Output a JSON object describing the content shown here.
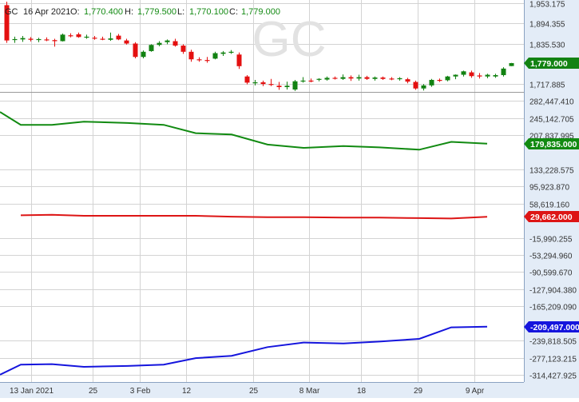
{
  "header": {
    "symbol": "GC",
    "date": "16 Apr 2021",
    "o_label": "O:",
    "o_value": "1,770.400",
    "h_label": "H:",
    "h_value": "1,779.500",
    "l_label": "L:",
    "l_value": "1,770.100",
    "c_label": "C:",
    "c_value": "1,779.000"
  },
  "watermark": "GC",
  "colors": {
    "up": "#128212",
    "down": "#e41010",
    "green_line": "#118a11",
    "red_line": "#dd1515",
    "blue_line": "#1515dd",
    "axis_bg": "#e3ecf7",
    "grid": "#d3d3d3",
    "tick_text": "#333333",
    "header_value": "#138a13"
  },
  "chart_data": {
    "type": "candlestick+line",
    "x_ticks": [
      {
        "label": "13 Jan 2021",
        "date": "2021-01-13"
      },
      {
        "label": "25",
        "date": "2021-01-25"
      },
      {
        "label": "3 Feb",
        "date": "2021-02-03"
      },
      {
        "label": "12",
        "date": "2021-02-12"
      },
      {
        "label": "25",
        "date": "2021-02-25"
      },
      {
        "label": "8 Mar",
        "date": "2021-03-08"
      },
      {
        "label": "18",
        "date": "2021-03-18"
      },
      {
        "label": "29",
        "date": "2021-03-29"
      },
      {
        "label": "9 Apr",
        "date": "2021-04-09"
      }
    ],
    "price_panel": {
      "y_ticks": [
        "1,953.175",
        "1,894.355",
        "1,835.530",
        "1,717.885"
      ],
      "y_range": [
        1695,
        1963
      ],
      "last_value_label": "1,779.000",
      "candles": [
        {
          "o": 1948,
          "h": 1958,
          "l": 1838,
          "c": 1845
        },
        {
          "o": 1847,
          "h": 1856,
          "l": 1838,
          "c": 1849
        },
        {
          "o": 1848,
          "h": 1858,
          "l": 1841,
          "c": 1852
        },
        {
          "o": 1850,
          "h": 1855,
          "l": 1842,
          "c": 1847
        },
        {
          "o": 1847,
          "h": 1853,
          "l": 1840,
          "c": 1849
        },
        {
          "o": 1848,
          "h": 1854,
          "l": 1843,
          "c": 1846
        },
        {
          "o": 1846,
          "h": 1850,
          "l": 1827,
          "c": 1843
        },
        {
          "o": 1843,
          "h": 1865,
          "l": 1842,
          "c": 1862
        },
        {
          "o": 1860,
          "h": 1866,
          "l": 1854,
          "c": 1858
        },
        {
          "o": 1863,
          "h": 1868,
          "l": 1853,
          "c": 1855
        },
        {
          "o": 1855,
          "h": 1862,
          "l": 1850,
          "c": 1856
        },
        {
          "o": 1853,
          "h": 1858,
          "l": 1847,
          "c": 1852
        },
        {
          "o": 1850,
          "h": 1856,
          "l": 1846,
          "c": 1849
        },
        {
          "o": 1847,
          "h": 1868,
          "l": 1844,
          "c": 1851
        },
        {
          "o": 1859,
          "h": 1864,
          "l": 1846,
          "c": 1848
        },
        {
          "o": 1845,
          "h": 1850,
          "l": 1833,
          "c": 1836
        },
        {
          "o": 1836,
          "h": 1840,
          "l": 1793,
          "c": 1797
        },
        {
          "o": 1797,
          "h": 1816,
          "l": 1793,
          "c": 1812
        },
        {
          "o": 1814,
          "h": 1834,
          "l": 1812,
          "c": 1832
        },
        {
          "o": 1832,
          "h": 1843,
          "l": 1828,
          "c": 1838
        },
        {
          "o": 1840,
          "h": 1848,
          "l": 1834,
          "c": 1845
        },
        {
          "o": 1843,
          "h": 1850,
          "l": 1827,
          "c": 1830
        },
        {
          "o": 1830,
          "h": 1834,
          "l": 1806,
          "c": 1812
        },
        {
          "o": 1812,
          "h": 1818,
          "l": 1783,
          "c": 1790
        },
        {
          "o": 1790,
          "h": 1796,
          "l": 1783,
          "c": 1788
        },
        {
          "o": 1788,
          "h": 1797,
          "l": 1780,
          "c": 1786
        },
        {
          "o": 1792,
          "h": 1812,
          "l": 1790,
          "c": 1808
        },
        {
          "o": 1806,
          "h": 1814,
          "l": 1800,
          "c": 1810
        },
        {
          "o": 1810,
          "h": 1817,
          "l": 1806,
          "c": 1812
        },
        {
          "o": 1804,
          "h": 1810,
          "l": 1762,
          "c": 1770
        },
        {
          "o": 1740,
          "h": 1744,
          "l": 1717,
          "c": 1722
        },
        {
          "o": 1722,
          "h": 1730,
          "l": 1714,
          "c": 1723
        },
        {
          "o": 1723,
          "h": 1728,
          "l": 1712,
          "c": 1718
        },
        {
          "o": 1718,
          "h": 1733,
          "l": 1712,
          "c": 1716
        },
        {
          "o": 1713,
          "h": 1724,
          "l": 1701,
          "c": 1709
        },
        {
          "o": 1709,
          "h": 1725,
          "l": 1702,
          "c": 1713
        },
        {
          "o": 1702,
          "h": 1730,
          "l": 1698,
          "c": 1726
        },
        {
          "o": 1726,
          "h": 1738,
          "l": 1722,
          "c": 1728
        },
        {
          "o": 1728,
          "h": 1734,
          "l": 1723,
          "c": 1727
        },
        {
          "o": 1731,
          "h": 1735,
          "l": 1726,
          "c": 1733
        },
        {
          "o": 1731,
          "h": 1740,
          "l": 1728,
          "c": 1736
        },
        {
          "o": 1736,
          "h": 1740,
          "l": 1731,
          "c": 1735
        },
        {
          "o": 1733,
          "h": 1746,
          "l": 1730,
          "c": 1738
        },
        {
          "o": 1738,
          "h": 1743,
          "l": 1727,
          "c": 1734
        },
        {
          "o": 1734,
          "h": 1745,
          "l": 1728,
          "c": 1738
        },
        {
          "o": 1738,
          "h": 1742,
          "l": 1730,
          "c": 1733
        },
        {
          "o": 1733,
          "h": 1740,
          "l": 1728,
          "c": 1737
        },
        {
          "o": 1737,
          "h": 1740,
          "l": 1730,
          "c": 1733
        },
        {
          "o": 1734,
          "h": 1738,
          "l": 1729,
          "c": 1732
        },
        {
          "o": 1732,
          "h": 1738,
          "l": 1728,
          "c": 1735
        },
        {
          "o": 1732,
          "h": 1736,
          "l": 1720,
          "c": 1725
        },
        {
          "o": 1724,
          "h": 1728,
          "l": 1701,
          "c": 1705
        },
        {
          "o": 1705,
          "h": 1718,
          "l": 1699,
          "c": 1714
        },
        {
          "o": 1714,
          "h": 1733,
          "l": 1710,
          "c": 1730
        },
        {
          "o": 1730,
          "h": 1734,
          "l": 1724,
          "c": 1728
        },
        {
          "o": 1729,
          "h": 1742,
          "l": 1726,
          "c": 1740
        },
        {
          "o": 1740,
          "h": 1746,
          "l": 1732,
          "c": 1745
        },
        {
          "o": 1745,
          "h": 1757,
          "l": 1740,
          "c": 1755
        },
        {
          "o": 1752,
          "h": 1757,
          "l": 1736,
          "c": 1741
        },
        {
          "o": 1743,
          "h": 1750,
          "l": 1734,
          "c": 1740
        },
        {
          "o": 1740,
          "h": 1748,
          "l": 1735,
          "c": 1745
        },
        {
          "o": 1740,
          "h": 1748,
          "l": 1736,
          "c": 1744
        },
        {
          "o": 1744,
          "h": 1767,
          "l": 1740,
          "c": 1763
        },
        {
          "o": 1770.4,
          "h": 1779.5,
          "l": 1770.1,
          "c": 1779
        }
      ]
    },
    "cot_panel": {
      "y_ticks": [
        "282,447.410",
        "245,142.705",
        "207,837.995",
        "133,228.575",
        "95,923.870",
        "58,619.160",
        "-15,990.255",
        "-53,294.960",
        "-90,599.670",
        "-127,904.380",
        "-165,209.090",
        "-239,818.505",
        "-277,123.215",
        "-314,427.925"
      ],
      "y_range": [
        -330000,
        300000
      ],
      "series": [
        {
          "color_key": "green_line",
          "last_value_label": "179,835.000",
          "values": [
            258000,
            230000,
            230000,
            237000,
            234000,
            230000,
            212000,
            209000,
            187000,
            180000,
            184000,
            181000,
            176000,
            193000,
            189000
          ]
        },
        {
          "color_key": "red_line",
          "last_value_label": "29,662.000",
          "values": [
            33000,
            34000,
            32000,
            32000,
            32000,
            32000,
            30000,
            29000,
            29000,
            28000,
            28000,
            27000,
            26000,
            29662
          ]
        },
        {
          "color_key": "blue_line",
          "last_value_label": "-209,497.000",
          "values": [
            -314000,
            -292000,
            -291000,
            -297000,
            -295000,
            -292000,
            -278000,
            -273000,
            -254000,
            -244000,
            -246000,
            -242000,
            -236000,
            -211000,
            -209497
          ]
        }
      ]
    }
  }
}
